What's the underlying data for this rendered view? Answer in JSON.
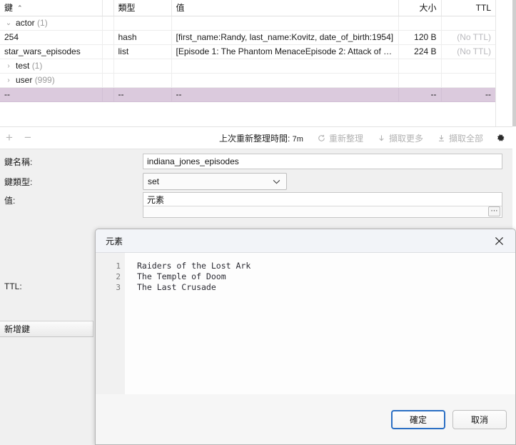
{
  "table": {
    "columns": [
      {
        "label": "鍵",
        "align": "left",
        "sort": "asc"
      },
      {
        "label": "",
        "align": "left",
        "sort": ""
      },
      {
        "label": "類型",
        "align": "left",
        "sort": ""
      },
      {
        "label": "值",
        "align": "left",
        "sort": ""
      },
      {
        "label": "大小",
        "align": "right",
        "sort": ""
      },
      {
        "label": "TTL",
        "align": "right",
        "sort": ""
      }
    ],
    "sort_caret": "⌃",
    "rows": [
      {
        "twisty": "⌄",
        "indent": false,
        "key": "actor",
        "count": "(1)",
        "type": "",
        "value": "",
        "size": "",
        "ttl": "",
        "ttl_empty": false,
        "selected": false
      },
      {
        "twisty": "",
        "indent": true,
        "key": "254",
        "count": "",
        "type": "hash",
        "value": "[first_name:Randy, last_name:Kovitz, date_of_birth:1954]",
        "size": "120 B",
        "ttl": "(No TTL)",
        "ttl_empty": true,
        "selected": false
      },
      {
        "twisty": "",
        "indent": true,
        "key": "star_wars_episodes",
        "count": "",
        "type": "list",
        "value": "[Episode 1: The Phantom MenaceEpisode 2: Attack of the…",
        "size": "224 B",
        "ttl": "(No TTL)",
        "ttl_empty": true,
        "selected": false
      },
      {
        "twisty": "›",
        "indent": false,
        "key": "test",
        "count": "(1)",
        "type": "",
        "value": "",
        "size": "",
        "ttl": "",
        "ttl_empty": false,
        "selected": false
      },
      {
        "twisty": "›",
        "indent": false,
        "key": "user",
        "count": "(999)",
        "type": "",
        "value": "",
        "size": "",
        "ttl": "",
        "ttl_empty": false,
        "selected": false
      },
      {
        "twisty": "",
        "indent": true,
        "key": "--",
        "count": "",
        "type": "--",
        "value": "--",
        "size": "--",
        "ttl": "--",
        "ttl_empty": false,
        "selected": true
      }
    ]
  },
  "toolbar": {
    "add_label": "+",
    "remove_label": "−",
    "status_label": "上次重新整理時間:",
    "status_value": "7m",
    "refresh_label": "重新整理",
    "fetch_more_label": "擷取更多",
    "fetch_all_label": "擷取全部"
  },
  "form": {
    "key_name_label": "鍵名稱:",
    "key_name_value": "indiana_jones_episodes",
    "key_type_label": "鍵類型:",
    "key_type_value": "set",
    "value_label": "值:",
    "values_header": "元素",
    "ellipsis_label": "⋯",
    "ttl_label": "TTL:"
  },
  "bottom": {
    "add_key_label": "新增鍵"
  },
  "dialog": {
    "title": "元素",
    "close_label": "✕",
    "lines": [
      {
        "n": "1",
        "text": "Raiders of the Lost Ark"
      },
      {
        "n": "2",
        "text": "The Temple of Doom"
      },
      {
        "n": "3",
        "text": "The Last Crusade"
      }
    ],
    "ok_label": "確定",
    "cancel_label": "取消"
  },
  "colors": {
    "selection": "#dbcadd",
    "accent_focus": "#2b6fc4",
    "muted_text": "#9b9b9b",
    "disabled_text": "#b3b3b3"
  }
}
